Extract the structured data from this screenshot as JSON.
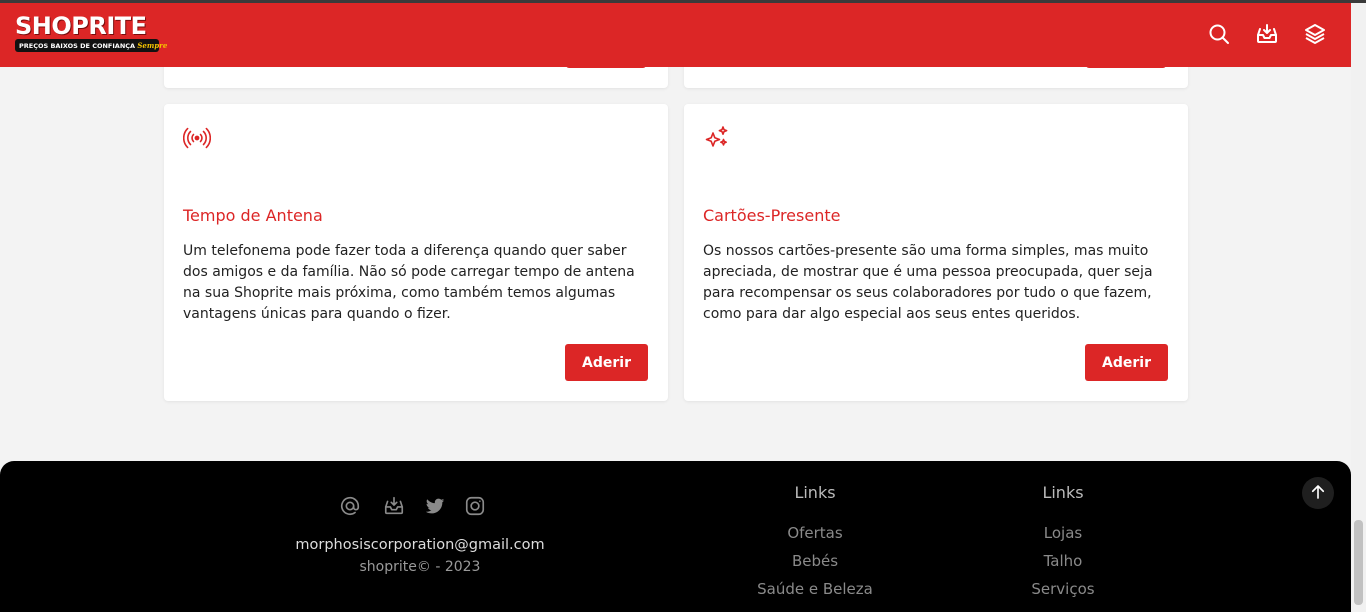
{
  "header": {
    "logo_text": "SHOPRITE",
    "logo_tagline": "PREÇOS BAIXOS DE CONFIANÇA",
    "logo_tagline_script": "Sempre",
    "icons": [
      "search-icon",
      "inbox-icon",
      "layers-icon"
    ]
  },
  "colors": {
    "brand": "#dc2626",
    "footer": "#000000"
  },
  "cards": [
    {
      "icon": "broadcast-icon",
      "title": "Tempo de Antena",
      "text": "Um telefonema pode fazer toda a diferença quando quer saber dos amigos e da família. Não só pode carregar tempo de antena na sua Shoprite mais próxima, como também temos algumas vantagens únicas para quando o fizer.",
      "button": "Aderir"
    },
    {
      "icon": "sparkles-icon",
      "title": "Cartões-Presente",
      "text": "Os nossos cartões-presente são uma forma simples, mas muito apreciada, de mostrar que é uma pessoa preocupada, quer seja para recompensar os seus colaboradores por tudo o que fazem, como para dar algo especial aos seus entes queridos.",
      "button": "Aderir"
    }
  ],
  "footer": {
    "social_icons": [
      "at-icon",
      "inbox-icon",
      "twitter-icon",
      "instagram-icon"
    ],
    "email": "morphosiscorporation@gmail.com",
    "copyright": "shoprite© - 2023",
    "columns": [
      {
        "title": "Links",
        "links": [
          "Ofertas",
          "Bebés",
          "Saúde e Beleza"
        ]
      },
      {
        "title": "Links",
        "links": [
          "Lojas",
          "Talho",
          "Serviços"
        ]
      }
    ]
  }
}
